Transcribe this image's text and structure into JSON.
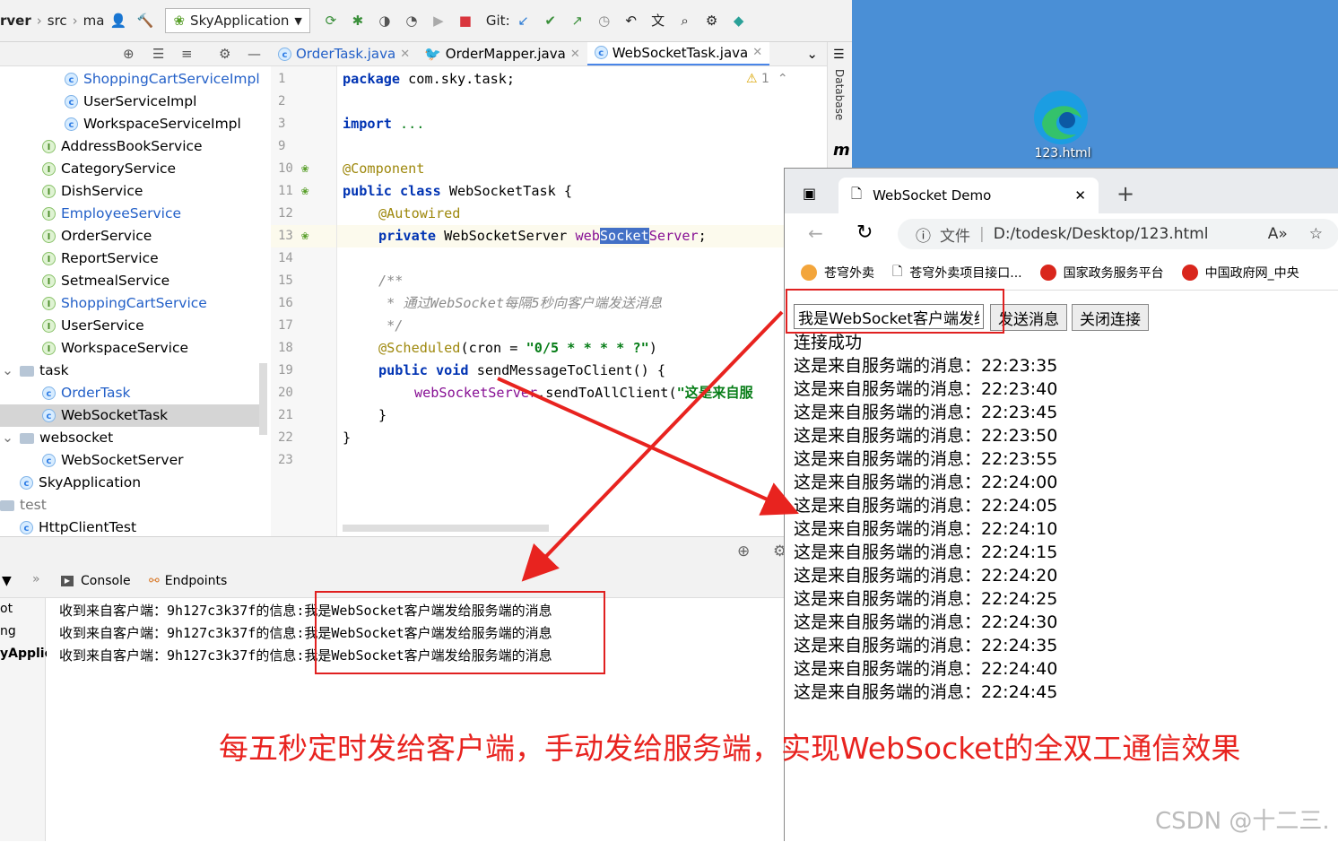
{
  "toolbar": {
    "crumbs": [
      "rver",
      "src",
      "ma"
    ],
    "run_config": "SkyApplication",
    "git_label": "Git:"
  },
  "tree": {
    "items": [
      {
        "label": "ShoppingCartServiceImpl",
        "kind": "class",
        "blue": true
      },
      {
        "label": "UserServiceImpl",
        "kind": "class"
      },
      {
        "label": "WorkspaceServiceImpl",
        "kind": "class"
      },
      {
        "label": "AddressBookService",
        "kind": "interface"
      },
      {
        "label": "CategoryService",
        "kind": "interface"
      },
      {
        "label": "DishService",
        "kind": "interface"
      },
      {
        "label": "EmployeeService",
        "kind": "interface",
        "blue": true
      },
      {
        "label": "OrderService",
        "kind": "interface"
      },
      {
        "label": "ReportService",
        "kind": "interface"
      },
      {
        "label": "SetmealService",
        "kind": "interface"
      },
      {
        "label": "ShoppingCartService",
        "kind": "interface",
        "blue": true
      },
      {
        "label": "UserService",
        "kind": "interface"
      },
      {
        "label": "WorkspaceService",
        "kind": "interface"
      },
      {
        "label": "task",
        "kind": "folder"
      },
      {
        "label": "OrderTask",
        "kind": "class",
        "blue": true
      },
      {
        "label": "WebSocketTask",
        "kind": "class",
        "selected": true
      },
      {
        "label": "websocket",
        "kind": "folder"
      },
      {
        "label": "WebSocketServer",
        "kind": "class"
      },
      {
        "label": "SkyApplication",
        "kind": "app"
      },
      {
        "label": "test",
        "kind": "folder-plain"
      },
      {
        "label": "HttpClientTest",
        "kind": "class"
      }
    ]
  },
  "editor": {
    "tabs": [
      "OrderTask.java",
      "OrderMapper.java",
      "WebSocketTask.java"
    ],
    "warning_count": "1",
    "line_numbers": [
      "1",
      "2",
      "3",
      "9",
      "10",
      "11",
      "12",
      "13",
      "14",
      "15",
      "16",
      "17",
      "18",
      "19",
      "20",
      "21",
      "22",
      "23"
    ],
    "code": {
      "l1_kw": "package",
      "l1_rest": " com.sky.task;",
      "l3_kw": "import",
      "l3_rest": " ...",
      "l10": "@Component",
      "l11_kw": "public class",
      "l11_rest": " WebSocketTask {",
      "l12": "@Autowired",
      "l13_kw": "private",
      "l13_type": " WebSocketServer ",
      "l13_a": "web",
      "l13_hl": "Socket",
      "l13_b": "Server",
      "l13_end": ";",
      "l15": "/**",
      "l16": " * 通过WebSocket每隔5秒向客户端发送消息",
      "l17": " */",
      "l18_an": "@Scheduled",
      "l18_a": "(cron = ",
      "l18_str": "\"0/5 * * * * ?\"",
      "l18_end": ")",
      "l19_kw": "public void",
      "l19_rest": " sendMessageToClient() {",
      "l20_fld": "webSocketServer",
      "l20_rest": ".sendToAllClient(",
      "l20_str": "\"这是来自服",
      "l21": "}",
      "l22": "}"
    }
  },
  "right_strip": {
    "database": "Database",
    "m": "m"
  },
  "run_panel": {
    "tabs": [
      "Console",
      "Endpoints"
    ],
    "left_labels": [
      "ot",
      "ng",
      "yApplic"
    ],
    "console_lines": [
      {
        "prefix": "收到来自客户端：9h127c3k37f的信息:",
        "msg": "我是WebSocket客户端发给服务端的消息"
      },
      {
        "prefix": "收到来自客户端：9h127c3k37f的信息:",
        "msg": "我是WebSocket客户端发给服务端的消息"
      },
      {
        "prefix": "收到来自客户端：9h127c3k37f的信息:",
        "msg": "我是WebSocket客户端发给服务端的消息"
      }
    ]
  },
  "desktop": {
    "icon_label": "123.html",
    "bg": "#4a8fd6"
  },
  "browser": {
    "tab_title": "WebSocket Demo",
    "url_prefix": "文件",
    "url": "D:/todesk/Desktop/123.html",
    "favorites": [
      "苍穹外卖",
      "苍穹外卖项目接口...",
      "国家政务服务平台",
      "中国政府网_中央"
    ],
    "input_value": "我是WebSocket客户端发给",
    "send_button": "发送消息",
    "close_button": "关闭连接",
    "status": "连接成功",
    "messages": [
      "这是来自服务端的消息：22:23:35",
      "这是来自服务端的消息：22:23:40",
      "这是来自服务端的消息：22:23:45",
      "这是来自服务端的消息：22:23:50",
      "这是来自服务端的消息：22:23:55",
      "这是来自服务端的消息：22:24:00",
      "这是来自服务端的消息：22:24:05",
      "这是来自服务端的消息：22:24:10",
      "这是来自服务端的消息：22:24:15",
      "这是来自服务端的消息：22:24:20",
      "这是来自服务端的消息：22:24:25",
      "这是来自服务端的消息：22:24:30",
      "这是来自服务端的消息：22:24:35",
      "这是来自服务端的消息：22:24:40",
      "这是来自服务端的消息：22:24:45"
    ]
  },
  "annotation": {
    "caption": "每五秒定时发给客户端，手动发给服务端，实现WebSocket的全双工通信效果",
    "color": "#e8231f"
  },
  "watermark": "CSDN @十二三."
}
